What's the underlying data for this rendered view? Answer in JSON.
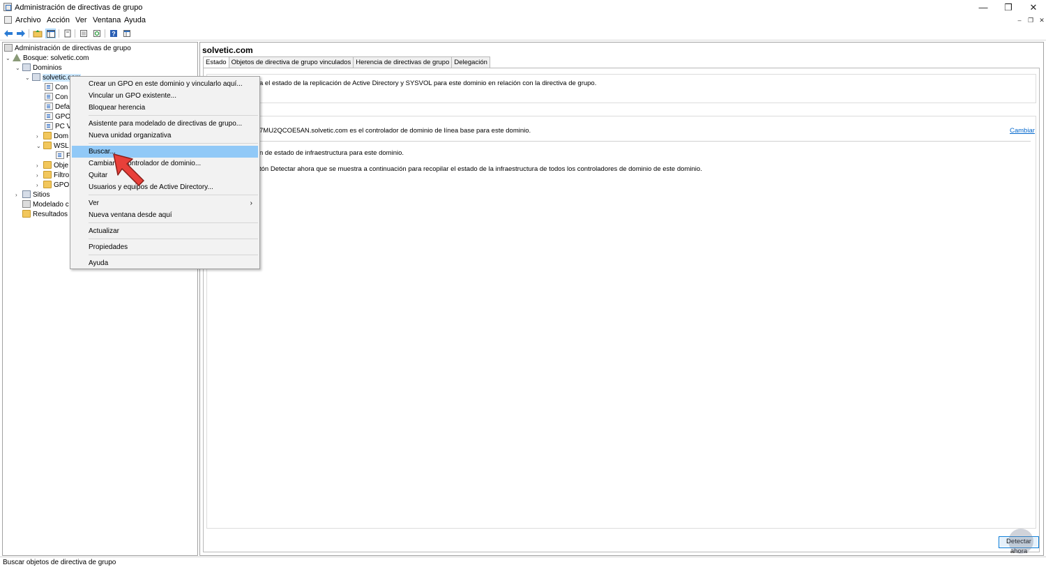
{
  "window": {
    "title": "Administración de directivas de grupo",
    "minimize": "—",
    "maximize": "❐",
    "close": "✕"
  },
  "menubar": {
    "items": [
      "Archivo",
      "Acción",
      "Ver",
      "Ventana",
      "Ayuda"
    ],
    "mdi_minimize": "–",
    "mdi_restore": "❐",
    "mdi_close": "✕"
  },
  "toolbar": {
    "icons": [
      "back-icon",
      "forward-icon",
      "up-folder-icon",
      "show-tree-icon",
      "delete-icon",
      "properties-icon",
      "refresh-icon",
      "help-icon",
      "export-icon"
    ]
  },
  "tree": {
    "root": "Administración de directivas de grupo",
    "forest": "Bosque: solvetic.com",
    "domains": "Dominios",
    "domain": "solvetic.com",
    "children": [
      "Con",
      "Con",
      "Defa",
      "GPO",
      "PC V",
      "Dom",
      "WSL",
      "P",
      "Obje",
      "Filtro",
      "GPO"
    ],
    "sites": "Sitios",
    "modeling": "Modelado c",
    "results": "Resultados"
  },
  "right": {
    "heading": "solvetic.com",
    "tabs": [
      "Estado",
      "Objetos de directiva de grupo vinculados",
      "Herencia de directivas de grupo",
      "Delegación"
    ],
    "status_text_1": "a el estado de la replicación de Active Directory y SYSVOL para este dominio en relación con la directiva de grupo.",
    "baseline_text": "7MU2QCOE5AN.solvetic.com es el controlador de dominio de línea base para este dominio.",
    "change_link": "Cambiar",
    "infra_text": "n de estado de infraestructura para este dominio.",
    "detect_text": "tón Detectar ahora que se muestra a continuación para recopilar el estado de la infraestructura de todos los controladores de dominio de este dominio.",
    "detect_button": "Detectar ahora"
  },
  "context_menu": {
    "items": [
      "Crear un GPO en este dominio y vincularlo aquí...",
      "Vincular un GPO existente...",
      "Bloquear herencia",
      "Asistente para modelado de directivas de grupo...",
      "Nueva unidad organizativa",
      "Buscar...",
      "Cambiar el controlador de dominio...",
      "Quitar",
      "Usuarios y equipos de Active Directory...",
      "Ver",
      "Nueva ventana desde aquí",
      "Actualizar",
      "Propiedades",
      "Ayuda"
    ],
    "highlighted": "Buscar...",
    "submenu_arrow": "›"
  },
  "statusbar": {
    "text": "Buscar objetos de directiva de grupo"
  },
  "colors": {
    "menu_hover": "#91c9f7",
    "selection": "#cce8ff",
    "link": "#0066cc",
    "pointer": "#e8403a"
  }
}
